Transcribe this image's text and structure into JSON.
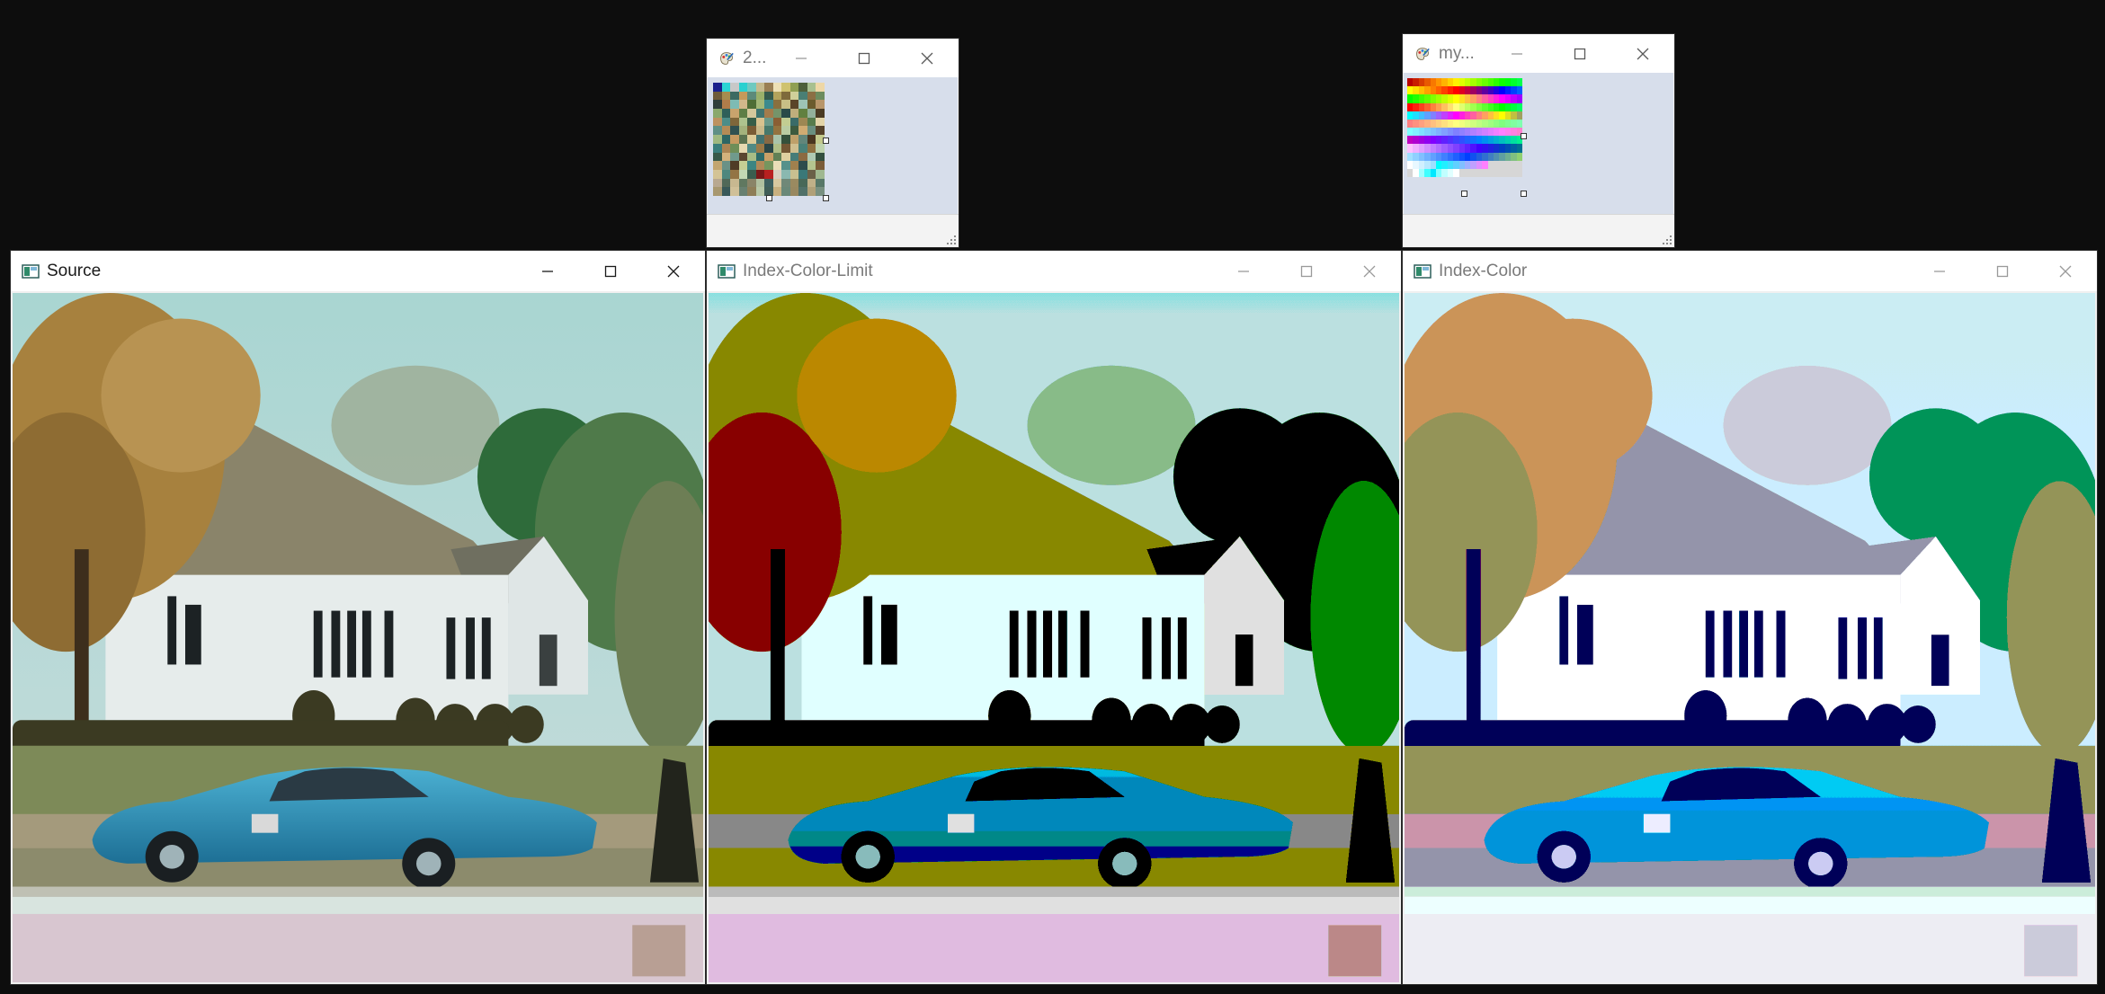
{
  "windows": {
    "source": {
      "title": "Source",
      "active": true
    },
    "index_color_limit": {
      "title": "Index-Color-Limit",
      "active": false
    },
    "index_color": {
      "title": "Index-Color",
      "active": false
    },
    "palette_small_1": {
      "title": "2..."
    },
    "palette_small_2": {
      "title": "my..."
    }
  },
  "icons": {
    "app": "opencv-window-icon",
    "paint": "paint-palette-icon",
    "minimize": "minimize-icon",
    "maximize": "maximize-icon",
    "close": "close-icon"
  },
  "palette_small_1": {
    "rows": 13,
    "cols": 13,
    "colors": [
      "#1a1f8c",
      "#2bd4d4",
      "#c8c8c8",
      "#2ad0d0",
      "#6fc9c0",
      "#c6ba8e",
      "#9a7f54",
      "#ede0b5",
      "#cfc26f",
      "#8f9f52",
      "#4d5f3a",
      "#a8c090",
      "#eed7a6",
      "#6e5a38",
      "#a68d4f",
      "#3b6a62",
      "#c49a5a",
      "#5d8a7a",
      "#9ab06a",
      "#355a4d",
      "#b3a35c",
      "#7e6a3b",
      "#cfd09a",
      "#497f74",
      "#8b6f44",
      "#6d8c5e",
      "#2f3d3a",
      "#b07c4a",
      "#7dbbb4",
      "#d2b88a",
      "#4f6e36",
      "#a3b878",
      "#3c8a8e",
      "#89703f",
      "#c7bf86",
      "#5a4428",
      "#9ec3b5",
      "#6b5b2d",
      "#b8966a",
      "#8aa86c",
      "#2e5f59",
      "#c8a36d",
      "#5e7e46",
      "#d5c89c",
      "#3e7470",
      "#a27c4c",
      "#75946a",
      "#2a4a48",
      "#bfae7c",
      "#61803f",
      "#93b09a",
      "#4b3b23",
      "#bc9160",
      "#4c8d88",
      "#7e663a",
      "#aec38e",
      "#385e48",
      "#d8c28f",
      "#6b9a8a",
      "#8a5e34",
      "#c2cd92",
      "#3a6b68",
      "#9d8753",
      "#577c4c",
      "#e2d4a8",
      "#5f8f85",
      "#b48b56",
      "#2f5050",
      "#a4b27c",
      "#7a5c35",
      "#c9b98a",
      "#46786b",
      "#93733f",
      "#b9cca2",
      "#3d5a3e",
      "#d0ab72",
      "#6a8f7f",
      "#55422a",
      "#9fb880",
      "#2d6664",
      "#c59a61",
      "#5b7350",
      "#dccb98",
      "#42726f",
      "#876944",
      "#a9c4aa",
      "#34513b",
      "#bea06a",
      "#62867a",
      "#4a3620",
      "#c3c98c",
      "#3a7e7c",
      "#ab8453",
      "#6f8e58",
      "#e6d9b0",
      "#508a84",
      "#9b7a48",
      "#2b4646",
      "#b0bf88",
      "#735734",
      "#cfbf90",
      "#4a8178",
      "#8e7040",
      "#bed3ae",
      "#375849",
      "#d4b27c",
      "#709a8c",
      "#5a4630",
      "#a7bd85",
      "#2c6b6a",
      "#c9a067",
      "#618055",
      "#dfd0a0",
      "#467c78",
      "#8b6b42",
      "#aecab3",
      "#33503f",
      "#c2a570",
      "#6a9186",
      "#4f3c26",
      "#c6cf94",
      "#3c8582",
      "#b08958",
      "#76965e",
      "#eadfb8",
      "#55918b",
      "#a0804e",
      "#2d4c4c",
      "#b5c48e",
      "#7b5d38",
      "#d3c395",
      "#4e877e",
      "#937445",
      "#c3d8b4",
      "#3a5d4e",
      "#7a1818",
      "#b82020",
      "#d8d0c0",
      "#8ab8b0",
      "#c8c090",
      "#3a7878",
      "#6a6048",
      "#a0b890",
      "#b8a890",
      "#506858",
      "#c8b890",
      "#607860",
      "#8a8468",
      "#b0c0a0",
      "#3e6060",
      "#d8c8a0",
      "#708878",
      "#9a8a60",
      "#486858",
      "#c0b088",
      "#587868",
      "#a89870",
      "#385858",
      "#d0c098",
      "#688070",
      "#8e7e58",
      "#b8c8a8",
      "#405e58",
      "#c8b080",
      "#6a8878",
      "#988860",
      "#507068",
      "#b0a078",
      "#789080"
    ]
  },
  "palette_small_2": {
    "rows": 12,
    "cols": 20,
    "colors": [
      "#b80000",
      "#c81e00",
      "#d83c00",
      "#e85a00",
      "#f87800",
      "#ff9600",
      "#ffb400",
      "#ffd200",
      "#fff000",
      "#e0ff00",
      "#c2ff00",
      "#a4ff00",
      "#86ff00",
      "#68ff00",
      "#4aff00",
      "#2cff00",
      "#0eff00",
      "#00ff10",
      "#00ff2e",
      "#00ff4c",
      "#ffff00",
      "#ffe000",
      "#ffc000",
      "#ffa000",
      "#ff8000",
      "#ff6000",
      "#ff4000",
      "#ff2000",
      "#ff0000",
      "#e00020",
      "#c00040",
      "#a00060",
      "#800080",
      "#6000a0",
      "#4000c0",
      "#2000e0",
      "#0000ff",
      "#0020ff",
      "#0040ff",
      "#0060ff",
      "#00ff00",
      "#20ff00",
      "#40ff00",
      "#60ff00",
      "#80ff00",
      "#a0ff00",
      "#c0ff00",
      "#e0ff00",
      "#ffff00",
      "#ffe020",
      "#ffc040",
      "#ffa060",
      "#ff8080",
      "#ff60a0",
      "#ff40c0",
      "#ff20e0",
      "#ff00ff",
      "#e000ff",
      "#c000ff",
      "#a000ff",
      "#ff0000",
      "#ff2010",
      "#ff4020",
      "#ff6030",
      "#ff8040",
      "#ffa050",
      "#ffc060",
      "#ffe070",
      "#ffff80",
      "#e0ff70",
      "#c0ff60",
      "#a0ff50",
      "#80ff40",
      "#60ff30",
      "#40ff20",
      "#20ff10",
      "#00ff00",
      "#00ff20",
      "#00ff40",
      "#00ff60",
      "#00ffff",
      "#20e0ff",
      "#40c0ff",
      "#60a0ff",
      "#8080ff",
      "#a060ff",
      "#c040ff",
      "#e020ff",
      "#ff00ff",
      "#ff20e0",
      "#ff40c0",
      "#ff60a0",
      "#ff8080",
      "#ffa060",
      "#ffc040",
      "#ffe020",
      "#ffff00",
      "#e0e020",
      "#c0c040",
      "#a0a060",
      "#ff8080",
      "#ff9080",
      "#ffa080",
      "#ffb080",
      "#ffc080",
      "#ffd080",
      "#ffe080",
      "#fff080",
      "#ffff80",
      "#f0ff80",
      "#e0ff80",
      "#d0ff80",
      "#c0ff80",
      "#b0ff80",
      "#a0ff80",
      "#90ff80",
      "#80ff80",
      "#80ff90",
      "#80ffa0",
      "#80ffb0",
      "#80ffff",
      "#80f0ff",
      "#80e0ff",
      "#80d0ff",
      "#80c0ff",
      "#80b0ff",
      "#80a0ff",
      "#8090ff",
      "#8080ff",
      "#9080ff",
      "#a080ff",
      "#b080ff",
      "#c080ff",
      "#d080ff",
      "#e080ff",
      "#f080ff",
      "#ff80ff",
      "#ff80f0",
      "#ff80e0",
      "#ff80d0",
      "#c000c0",
      "#b000d0",
      "#a000e0",
      "#9000f0",
      "#8000ff",
      "#7010ff",
      "#6020ff",
      "#5030ff",
      "#4040ff",
      "#3050ff",
      "#2060ff",
      "#1070ff",
      "#0080ff",
      "#0090f0",
      "#00a0e0",
      "#00b0d0",
      "#00c0c0",
      "#00d0b0",
      "#00e0a0",
      "#00f090",
      "#ffc0ff",
      "#f0b0ff",
      "#e0a0ff",
      "#d090ff",
      "#c080ff",
      "#b070ff",
      "#a060ff",
      "#9050ff",
      "#8040ff",
      "#7030ff",
      "#6020ff",
      "#5010ff",
      "#4000ff",
      "#3010f0",
      "#2020e0",
      "#1030d0",
      "#0040c0",
      "#0050b0",
      "#0060a0",
      "#007090",
      "#a0e0ff",
      "#90d0ff",
      "#80c0ff",
      "#70b0ff",
      "#60a0ff",
      "#5090ff",
      "#4080ff",
      "#3070ff",
      "#2060ff",
      "#1050ff",
      "#0040ff",
      "#1050f0",
      "#2060e0",
      "#3070d0",
      "#4080c0",
      "#5090b0",
      "#60a0a0",
      "#70b090",
      "#80c080",
      "#90d070",
      "#ffffff",
      "#e8f8ff",
      "#d0f0ff",
      "#b8e8ff",
      "#a0e0ff",
      "#00ffff",
      "#20f0ff",
      "#40e0ff",
      "#60d0ff",
      "#80c0ff",
      "#a0b0ff",
      "#c0a0ff",
      "#e090ff",
      "#ff80ff",
      "#d6d6d6",
      "#d6d6d6",
      "#d6d6d6",
      "#d6d6d6",
      "#d6d6d6",
      "#d6d6d6",
      "#d6d6d6",
      "#ffffff",
      "#a0ffff",
      "#40ffff",
      "#00e8ff",
      "#80ffff",
      "#c0ffff",
      "#e0ffff",
      "#ffffff",
      "#d6d6d6",
      "#d6d6d6",
      "#d6d6d6",
      "#d6d6d6",
      "#d6d6d6",
      "#d6d6d6",
      "#d6d6d6",
      "#d6d6d6",
      "#d6d6d6",
      "#d6d6d6",
      "#d6d6d6"
    ]
  },
  "colors": {
    "desktop": "#0d0d0d",
    "titlebar": "#ffffff",
    "palette_bg": "#d7deeb"
  }
}
